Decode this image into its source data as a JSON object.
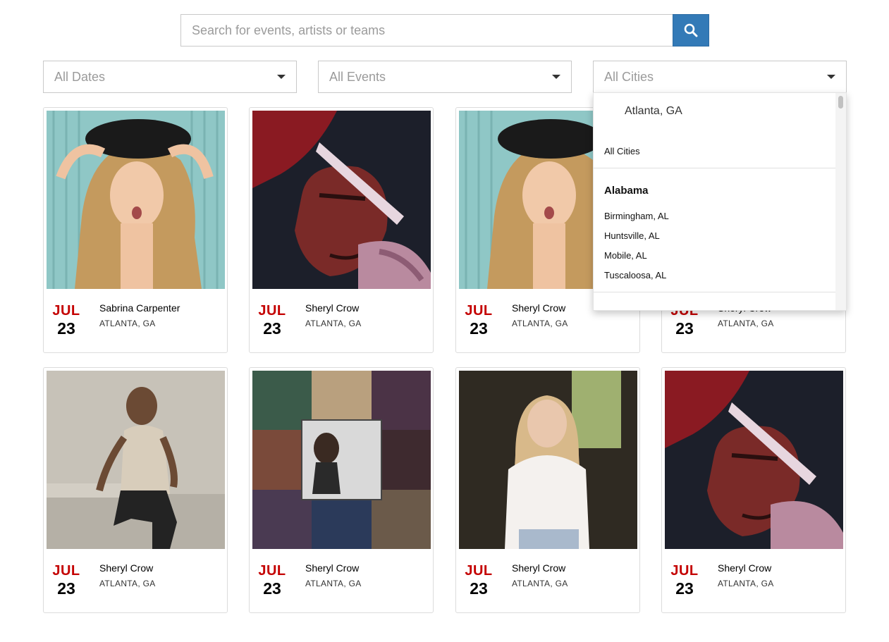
{
  "search": {
    "placeholder": "Search for events, artists or teams",
    "icon": "search-icon",
    "button_color": "#337ab7"
  },
  "filters": {
    "dates": "All Dates",
    "events": "All Events",
    "cities": "All Cities"
  },
  "city_dropdown": {
    "current": "Atlanta, GA",
    "all_option": "All Cities",
    "groups": [
      {
        "label": "Alabama",
        "options": [
          "Birmingham, AL",
          "Huntsville, AL",
          "Mobile, AL",
          "Tuscaloosa, AL"
        ]
      }
    ]
  },
  "accent_color": "#c40000",
  "events": [
    {
      "month": "JUL",
      "day": "23",
      "name": "Sabrina Carpenter",
      "city": "ATLANTA, GA"
    },
    {
      "month": "JUL",
      "day": "23",
      "name": "Sheryl Crow",
      "city": "ATLANTA, GA"
    },
    {
      "month": "JUL",
      "day": "23",
      "name": "Sheryl Crow",
      "city": "ATLANTA, GA"
    },
    {
      "month": "JUL",
      "day": "23",
      "name": "Sheryl Crow",
      "city": "ATLANTA, GA"
    },
    {
      "month": "JUL",
      "day": "23",
      "name": "Sheryl Crow",
      "city": "ATLANTA, GA"
    },
    {
      "month": "JUL",
      "day": "23",
      "name": "Sheryl Crow",
      "city": "ATLANTA, GA"
    },
    {
      "month": "JUL",
      "day": "23",
      "name": "Sheryl Crow",
      "city": "ATLANTA, GA"
    },
    {
      "month": "JUL",
      "day": "23",
      "name": "Sheryl Crow",
      "city": "ATLANTA, GA"
    }
  ]
}
